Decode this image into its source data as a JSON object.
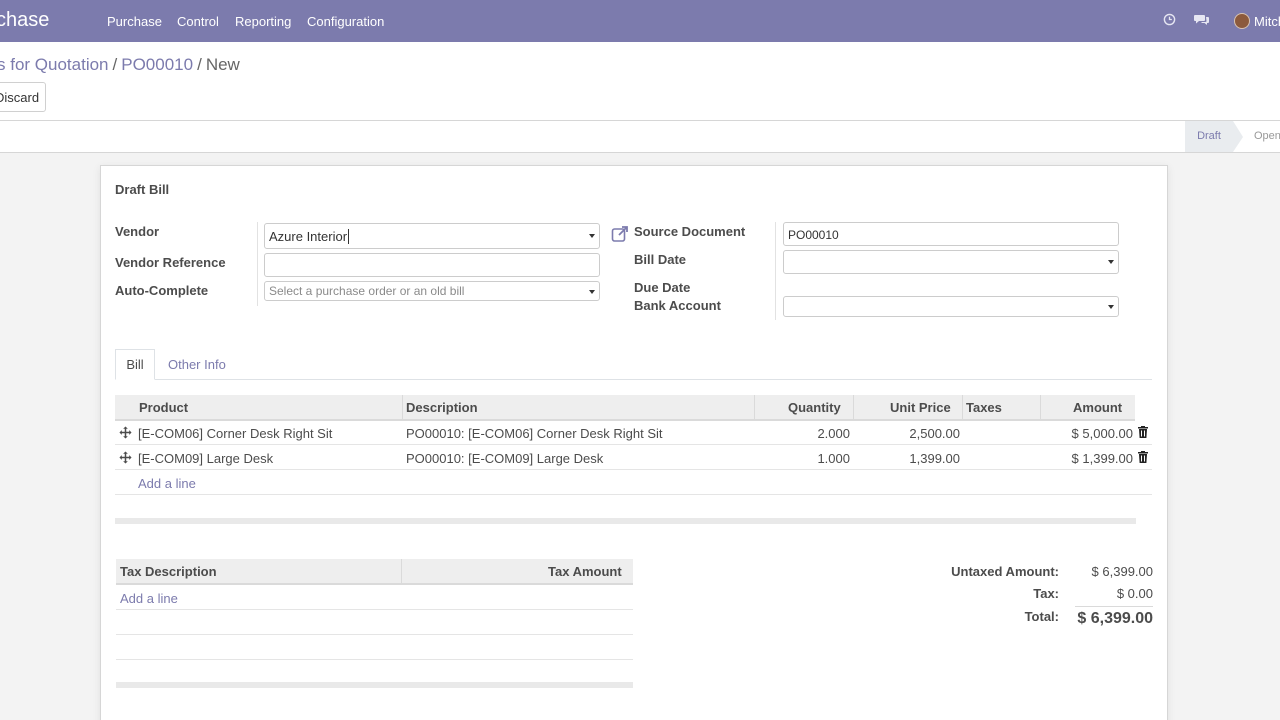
{
  "nav": {
    "app_name": "chase",
    "menu": [
      "Purchase",
      "Control",
      "Reporting",
      "Configuration"
    ],
    "user": "Mitch",
    "icons": [
      "clock-icon",
      "chat-icon"
    ]
  },
  "breadcrumb": {
    "parent": "s for Quotation",
    "record": "PO00010",
    "current": "New"
  },
  "actions": {
    "discard": "Discard"
  },
  "statusbar": {
    "steps": [
      "Draft",
      "Open"
    ],
    "active": "Draft"
  },
  "form": {
    "title": "Draft Bill",
    "vendor_label": "Vendor",
    "vendor_value": "Azure Interior",
    "vendor_ref_label": "Vendor Reference",
    "vendor_ref_value": "",
    "auto_complete_label": "Auto-Complete",
    "auto_complete_placeholder": "Select a purchase order or an old bill",
    "source_doc_label": "Source Document",
    "source_doc_value": "PO00010",
    "bill_date_label": "Bill Date",
    "due_date_label": "Due Date",
    "bank_account_label": "Bank Account"
  },
  "tabs": [
    "Bill",
    "Other Info"
  ],
  "lines": {
    "columns": [
      "Product",
      "Description",
      "Quantity",
      "Unit Price",
      "Taxes",
      "Amount"
    ],
    "rows": [
      {
        "product": "[E-COM06] Corner Desk Right Sit",
        "description": "PO00010: [E-COM06] Corner Desk Right Sit",
        "quantity": "2.000",
        "unit_price": "2,500.00",
        "taxes": "",
        "amount": "$ 5,000.00"
      },
      {
        "product": "[E-COM09] Large Desk",
        "description": "PO00010: [E-COM09] Large Desk",
        "quantity": "1.000",
        "unit_price": "1,399.00",
        "taxes": "",
        "amount": "$ 1,399.00"
      }
    ],
    "add_line": "Add a line"
  },
  "tax_table": {
    "columns": [
      "Tax Description",
      "Tax Amount"
    ],
    "add_line": "Add a line"
  },
  "totals": {
    "untaxed_label": "Untaxed Amount:",
    "untaxed_value": "$ 6,399.00",
    "tax_label": "Tax:",
    "tax_value": "$ 0.00",
    "total_label": "Total:",
    "total_value": "$ 6,399.00"
  },
  "colors": {
    "brand": "#7c7bad",
    "text": "#4c4c4c",
    "header_bg": "#eeeeee"
  }
}
